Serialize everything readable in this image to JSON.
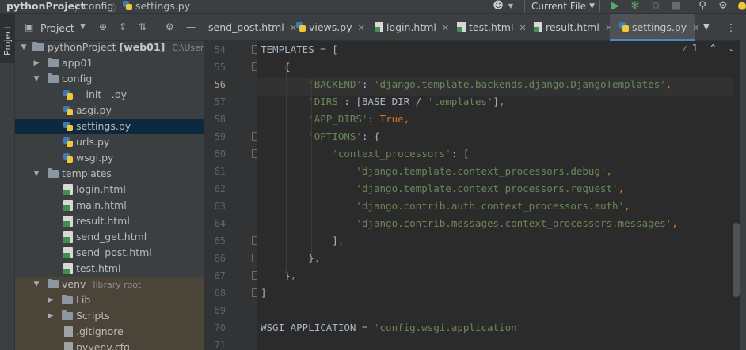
{
  "navbar": {
    "project": "pythonProject",
    "folder": "config",
    "file": "settings.py",
    "run_config": "Current File"
  },
  "left_stripe": {
    "project_tab": "Project"
  },
  "project_panel": {
    "title": "Project",
    "tree": [
      {
        "label": "pythonProject",
        "badge": "[web01]",
        "hint": "C:\\Users\\d",
        "kind": "root"
      },
      {
        "label": "app01",
        "kind": "folder"
      },
      {
        "label": "config",
        "kind": "folder"
      },
      {
        "label": "__init__.py",
        "kind": "py"
      },
      {
        "label": "asgi.py",
        "kind": "py"
      },
      {
        "label": "settings.py",
        "kind": "py"
      },
      {
        "label": "urls.py",
        "kind": "py"
      },
      {
        "label": "wsgi.py",
        "kind": "py"
      },
      {
        "label": "templates",
        "kind": "folder"
      },
      {
        "label": "login.html",
        "kind": "html"
      },
      {
        "label": "main.html",
        "kind": "html"
      },
      {
        "label": "result.html",
        "kind": "html"
      },
      {
        "label": "send_get.html",
        "kind": "html"
      },
      {
        "label": "send_post.html",
        "kind": "html"
      },
      {
        "label": "test.html",
        "kind": "html"
      },
      {
        "label": "venv",
        "hint": "library root",
        "kind": "folder"
      },
      {
        "label": "Lib",
        "kind": "folder"
      },
      {
        "label": "Scripts",
        "kind": "folder"
      },
      {
        "label": ".gitignore",
        "kind": "file"
      },
      {
        "label": "pyvenv.cfg",
        "kind": "file"
      }
    ]
  },
  "tabs": [
    {
      "label": "send_post.html",
      "kind": "html"
    },
    {
      "label": "views.py",
      "kind": "py"
    },
    {
      "label": "login.html",
      "kind": "html"
    },
    {
      "label": "test.html",
      "kind": "html"
    },
    {
      "label": "result.html",
      "kind": "html"
    },
    {
      "label": "settings.py",
      "kind": "py",
      "active": true
    }
  ],
  "inspection": {
    "count": "1"
  },
  "editor": {
    "current_line": "56",
    "lines": [
      {
        "n": "54",
        "tokens": [
          [
            "d",
            "TEMPLATES = ["
          ]
        ]
      },
      {
        "n": "55",
        "tokens": [
          [
            "d",
            "    {"
          ]
        ]
      },
      {
        "n": "56",
        "tokens": [
          [
            "d",
            "        "
          ],
          [
            "s",
            "'BACKEND'"
          ],
          [
            "d",
            ": "
          ],
          [
            "s",
            "'django.template.backends.django.DjangoTemplates'"
          ],
          [
            "k",
            ","
          ]
        ]
      },
      {
        "n": "57",
        "tokens": [
          [
            "d",
            "        "
          ],
          [
            "s",
            "'DIRS'"
          ],
          [
            "d",
            ": [BASE_DIR / "
          ],
          [
            "s",
            "'templates'"
          ],
          [
            "d",
            "]"
          ],
          [
            "k",
            ","
          ]
        ]
      },
      {
        "n": "58",
        "tokens": [
          [
            "d",
            "        "
          ],
          [
            "s",
            "'APP_DIRS'"
          ],
          [
            "d",
            ": "
          ],
          [
            "k",
            "True"
          ],
          [
            "k",
            ","
          ]
        ]
      },
      {
        "n": "59",
        "tokens": [
          [
            "d",
            "        "
          ],
          [
            "s",
            "'OPTIONS'"
          ],
          [
            "d",
            ": {"
          ]
        ]
      },
      {
        "n": "60",
        "tokens": [
          [
            "d",
            "            "
          ],
          [
            "s",
            "'context_processors'"
          ],
          [
            "d",
            ": ["
          ]
        ]
      },
      {
        "n": "61",
        "tokens": [
          [
            "d",
            "                "
          ],
          [
            "s",
            "'django.template.context_processors.debug'"
          ],
          [
            "k",
            ","
          ]
        ]
      },
      {
        "n": "62",
        "tokens": [
          [
            "d",
            "                "
          ],
          [
            "s",
            "'django.template.context_processors.request'"
          ],
          [
            "k",
            ","
          ]
        ]
      },
      {
        "n": "63",
        "tokens": [
          [
            "d",
            "                "
          ],
          [
            "s",
            "'django.contrib.auth.context_processors.auth'"
          ],
          [
            "k",
            ","
          ]
        ]
      },
      {
        "n": "64",
        "tokens": [
          [
            "d",
            "                "
          ],
          [
            "s",
            "'django.contrib.messages.context_processors.messages'"
          ],
          [
            "k",
            ","
          ]
        ]
      },
      {
        "n": "65",
        "tokens": [
          [
            "d",
            "            ]"
          ],
          [
            "k",
            ","
          ]
        ]
      },
      {
        "n": "66",
        "tokens": [
          [
            "d",
            "        }"
          ],
          [
            "k",
            ","
          ]
        ]
      },
      {
        "n": "67",
        "tokens": [
          [
            "d",
            "    }"
          ],
          [
            "k",
            ","
          ]
        ]
      },
      {
        "n": "68",
        "tokens": [
          [
            "d",
            "]"
          ]
        ]
      },
      {
        "n": "69",
        "tokens": []
      },
      {
        "n": "70",
        "tokens": [
          [
            "d",
            "WSGI_APPLICATION = "
          ],
          [
            "s",
            "'config.wsgi.application'"
          ]
        ]
      },
      {
        "n": "71",
        "tokens": []
      }
    ]
  }
}
